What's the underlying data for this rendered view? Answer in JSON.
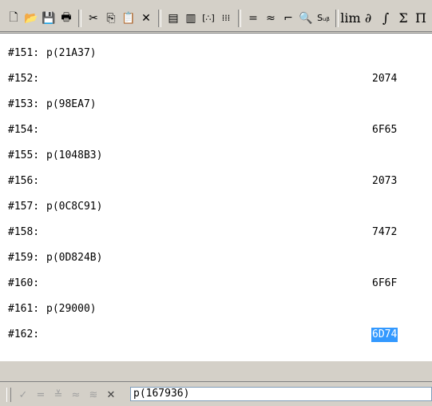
{
  "toolbar": {
    "buttons": [
      {
        "name": "new-icon",
        "glyph": "🗋"
      },
      {
        "name": "open-icon",
        "glyph": "📂"
      },
      {
        "name": "save-icon",
        "glyph": "💾"
      },
      {
        "name": "print-icon",
        "glyph": "🖶"
      },
      {
        "name": "cut-icon",
        "glyph": "✂"
      },
      {
        "name": "copy-icon",
        "glyph": "⎘"
      },
      {
        "name": "paste-icon",
        "glyph": "📋"
      },
      {
        "name": "delete-icon",
        "glyph": "✕"
      },
      {
        "name": "insert-text-icon",
        "glyph": "▤"
      },
      {
        "name": "insert-title-icon",
        "glyph": "▥"
      },
      {
        "name": "vector-icon",
        "glyph": "[∴]"
      },
      {
        "name": "matrix-icon",
        "glyph": "⁞⁞⁞"
      },
      {
        "name": "simplify-icon",
        "glyph": "="
      },
      {
        "name": "approximate-icon",
        "glyph": "≈"
      },
      {
        "name": "plot-2d-icon",
        "glyph": "⌐"
      },
      {
        "name": "solve-icon",
        "glyph": "🔍"
      },
      {
        "name": "substitute-icon",
        "glyph": "Sᵤᵦ"
      },
      {
        "name": "limit-icon",
        "glyph": "lim"
      },
      {
        "name": "derivative-icon",
        "glyph": "∂"
      },
      {
        "name": "integral-icon",
        "glyph": "∫"
      },
      {
        "name": "sum-icon",
        "glyph": "Σ"
      },
      {
        "name": "product-icon",
        "glyph": "Π"
      }
    ]
  },
  "rows": [
    {
      "label": "#151:",
      "expr": "p(21A37)",
      "result": ""
    },
    {
      "label": "#152:",
      "expr": "",
      "result": "2074"
    },
    {
      "label": "#153:",
      "expr": "p(98EA7)",
      "result": ""
    },
    {
      "label": "#154:",
      "expr": "",
      "result": "6F65"
    },
    {
      "label": "#155:",
      "expr": "p(1048B3)",
      "result": ""
    },
    {
      "label": "#156:",
      "expr": "",
      "result": "2073"
    },
    {
      "label": "#157:",
      "expr": "p(0C8C91)",
      "result": ""
    },
    {
      "label": "#158:",
      "expr": "",
      "result": "7472"
    },
    {
      "label": "#159:",
      "expr": "p(0D824B)",
      "result": ""
    },
    {
      "label": "#160:",
      "expr": "",
      "result": "6F6F"
    },
    {
      "label": "#161:",
      "expr": "p(29000)",
      "result": ""
    },
    {
      "label": "#162:",
      "expr": "",
      "result": "6D74",
      "selected": true
    }
  ],
  "entry": {
    "buttons": [
      {
        "name": "check-icon",
        "glyph": "✓"
      },
      {
        "name": "equals-icon",
        "glyph": "="
      },
      {
        "name": "check-equals-icon",
        "glyph": "≚"
      },
      {
        "name": "approx-icon",
        "glyph": "≈"
      },
      {
        "name": "check-approx-icon",
        "glyph": "≋"
      },
      {
        "name": "close-icon",
        "glyph": "✕"
      }
    ],
    "value": "p(167936)"
  }
}
